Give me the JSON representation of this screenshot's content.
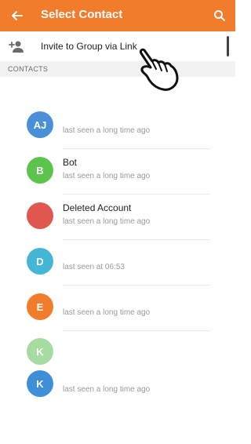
{
  "header": {
    "title": "Select Contact",
    "back_icon": "arrow-left-icon",
    "search_icon": "search-icon",
    "color": "#f07c2c"
  },
  "invite": {
    "label": "Invite to Group via Link",
    "icon": "add-person-icon"
  },
  "section": {
    "label": "CONTACTS"
  },
  "contacts": [
    {
      "initials": "AJ",
      "name": "",
      "status": "last seen a long time ago",
      "color": "#4a90d9"
    },
    {
      "initials": "B",
      "name": "Bot",
      "status": "last seen a long time ago",
      "color": "#5cc34c"
    },
    {
      "initials": "",
      "name": "Deleted Account",
      "status": "last seen a long time ago",
      "color": "#e0574f"
    },
    {
      "initials": "D",
      "name": "",
      "status": "last seen at 06:53",
      "color": "#45b6d6"
    },
    {
      "initials": "E",
      "name": "",
      "status": "last seen a long time ago",
      "color": "#f07c2c"
    },
    {
      "initials": "K",
      "name": "",
      "status": "",
      "color": "#a6dca0"
    },
    {
      "initials": "K",
      "name": "",
      "status": "last seen a long time ago",
      "color": "#3f8fd8"
    }
  ]
}
